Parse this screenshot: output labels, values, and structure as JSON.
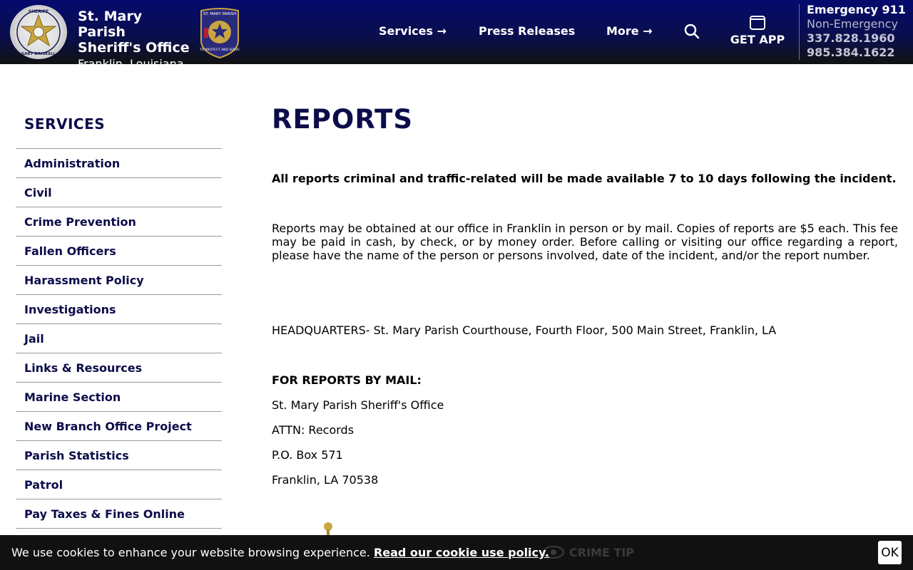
{
  "header": {
    "title": "St. Mary Parish Sheriff's Office",
    "location": "Franklin, Louisiana",
    "nav": [
      {
        "label": "Services →"
      },
      {
        "label": "Press Releases"
      },
      {
        "label": "More →"
      }
    ],
    "get_app": "GET APP",
    "emergency": {
      "line1": "Emergency 911",
      "line2": "Non-Emergency",
      "phone1": "337.828.1960",
      "phone2": "985.384.1622"
    },
    "badge_text_top": "SHERIFF",
    "badge_text_bottom": "GARY DRISKELL",
    "patch_text_top": "ST. MARY PARISH",
    "patch_text_bottom": "TO PROTECT AND SERVE"
  },
  "sidebar": {
    "title": "SERVICES",
    "items": [
      {
        "label": "Administration"
      },
      {
        "label": "Civil"
      },
      {
        "label": "Crime Prevention"
      },
      {
        "label": "Fallen Officers"
      },
      {
        "label": "Harassment Policy"
      },
      {
        "label": "Investigations"
      },
      {
        "label": "Jail"
      },
      {
        "label": "Links & Resources"
      },
      {
        "label": "Marine Section"
      },
      {
        "label": "New Branch Office Project"
      },
      {
        "label": "Parish Statistics"
      },
      {
        "label": "Patrol"
      },
      {
        "label": "Pay Taxes & Fines Online"
      }
    ]
  },
  "main": {
    "title": "REPORTS",
    "lead": "All reports criminal and traffic-related will be made available 7 to 10 days following the incident.",
    "paragraph": "Reports may be obtained at our office in Franklin in person or by mail. Copies of reports are $5 each. This fee may be paid in cash, by check, or by money order. Before calling or visiting our office regarding a report, please have the name of the person or persons involved, date of the incident, and/or the report number.",
    "headquarters": "HEADQUARTERS- St. Mary Parish Courthouse, Fourth Floor, 500 Main Street, Franklin, LA",
    "mail_heading": "FOR REPORTS BY MAIL:",
    "mail_address": [
      "St. Mary Parish Sheriff's Office",
      "ATTN: Records",
      "P.O. Box 571",
      "Franklin, LA 70538"
    ]
  },
  "bottom": {
    "crime_tip": "CRIME TIP"
  },
  "cookie": {
    "text": "We use cookies to enhance your website browsing experience.",
    "link": "Read our cookie use policy.",
    "ok": "OK"
  },
  "colors": {
    "header_top": "#050a6e",
    "header_bottom": "#121212",
    "navy_text": "#0c0c4a",
    "cookie_bar": "#111111"
  }
}
